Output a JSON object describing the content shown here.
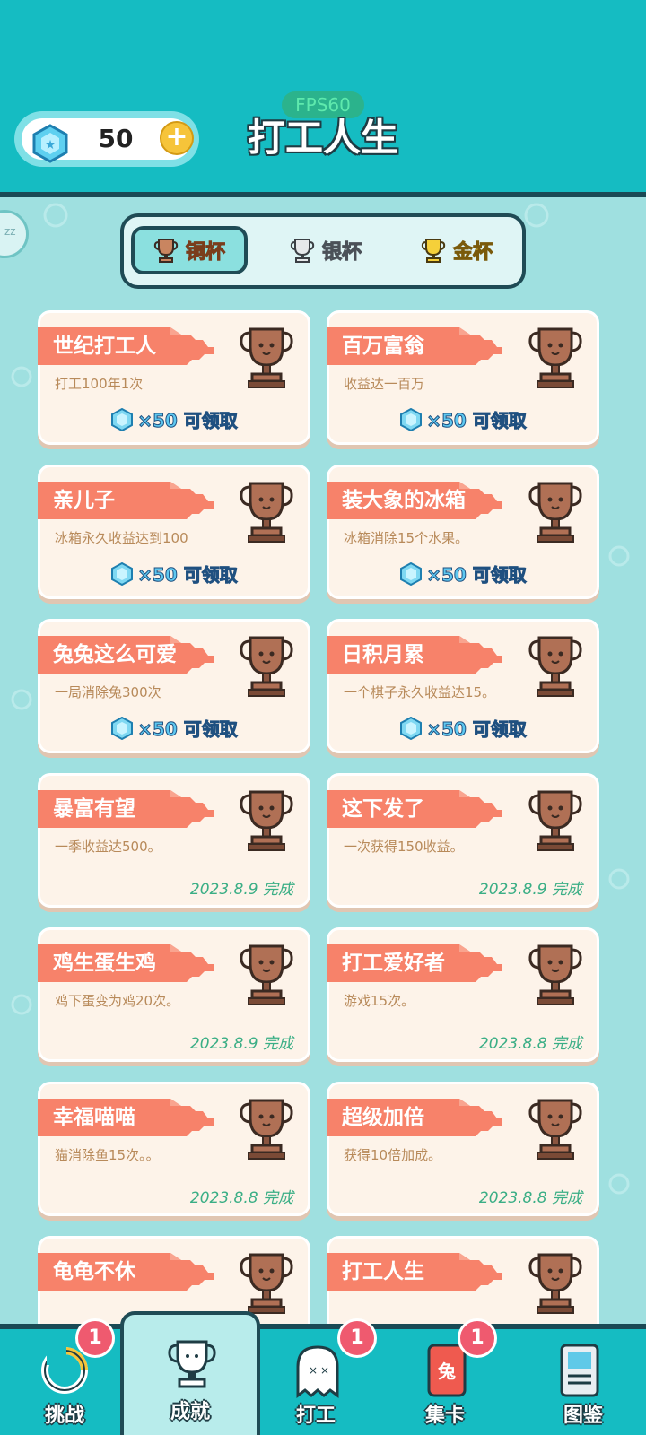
{
  "header": {
    "fps": "FPS60",
    "title": "打工人生",
    "gem_count": "50"
  },
  "tabs": [
    {
      "label": "铜杯",
      "active": true
    },
    {
      "label": "银杯",
      "active": false
    },
    {
      "label": "金杯",
      "active": false
    }
  ],
  "achievements": [
    {
      "title": "世纪打工人",
      "desc": "打工100年1次",
      "reward": "×50 可领取",
      "done": ""
    },
    {
      "title": "百万富翁",
      "desc": "收益达一百万",
      "reward": "×50 可领取",
      "done": ""
    },
    {
      "title": "亲儿子",
      "desc": "冰箱永久收益达到100",
      "reward": "×50 可领取",
      "done": ""
    },
    {
      "title": "装大象的冰箱",
      "desc": "冰箱消除15个水果。",
      "reward": "×50 可领取",
      "done": ""
    },
    {
      "title": "兔兔这么可爱",
      "desc": "一局消除兔300次",
      "reward": "×50 可领取",
      "done": ""
    },
    {
      "title": "日积月累",
      "desc": "一个棋子永久收益达15。",
      "reward": "×50 可领取",
      "done": ""
    },
    {
      "title": "暴富有望",
      "desc": "一季收益达500。",
      "reward": "",
      "done": "2023.8.9 完成"
    },
    {
      "title": "这下发了",
      "desc": "一次获得150收益。",
      "reward": "",
      "done": "2023.8.9 完成"
    },
    {
      "title": "鸡生蛋生鸡",
      "desc": "鸡下蛋变为鸡20次。",
      "reward": "",
      "done": "2023.8.9 完成"
    },
    {
      "title": "打工爱好者",
      "desc": "游戏15次。",
      "reward": "",
      "done": "2023.8.8 完成"
    },
    {
      "title": "幸福喵喵",
      "desc": "猫消除鱼15次。。",
      "reward": "",
      "done": "2023.8.8 完成"
    },
    {
      "title": "超级加倍",
      "desc": "获得10倍加成。",
      "reward": "",
      "done": "2023.8.8 完成"
    },
    {
      "title": "龟龟不休",
      "desc": "",
      "reward": "",
      "done": ""
    },
    {
      "title": "打工人生",
      "desc": "",
      "reward": "",
      "done": ""
    }
  ],
  "nav": [
    {
      "label": "挑战",
      "badge": "1",
      "icon": "challenge-icon",
      "active": false
    },
    {
      "label": "成就",
      "badge": "",
      "icon": "trophy-icon",
      "active": true
    },
    {
      "label": "打工",
      "badge": "1",
      "icon": "ghost-icon",
      "active": false
    },
    {
      "label": "集卡",
      "badge": "1",
      "icon": "card-icon",
      "active": false
    },
    {
      "label": "图鉴",
      "badge": "",
      "icon": "book-icon",
      "active": false
    }
  ],
  "colors": {
    "header": "#15bcc2",
    "banner": "#f7826a",
    "bronze": "#b07055",
    "done_text": "#3aae85"
  }
}
